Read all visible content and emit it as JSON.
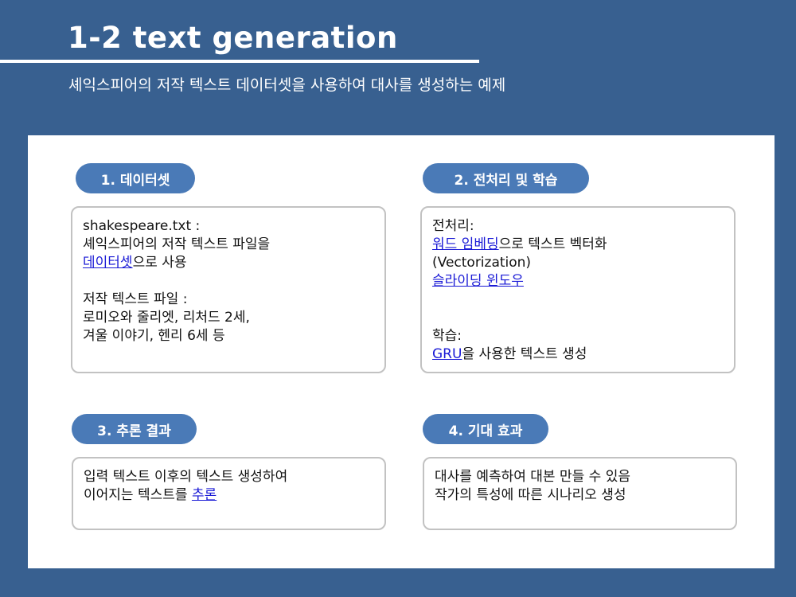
{
  "slide": {
    "title": "1-2 text generation",
    "subtitle": "셰익스피어의 저작 텍스트 데이터셋을 사용하여 대사를 생성하는 예제"
  },
  "sections": [
    {
      "heading": "1. 데이터셋",
      "lines": [
        {
          "text": "shakespeare.txt :"
        },
        {
          "text": "셰익스피어의 저작 텍스트 파일을"
        },
        {
          "link": "데이터셋",
          "rest": "으로 사용"
        },
        {
          "text": "저작 텍스트 파일 :"
        },
        {
          "text": "로미오와 줄리엣, 리처드 2세,"
        },
        {
          "text": "겨울 이야기, 헨리 6세 등"
        }
      ]
    },
    {
      "heading": "2. 전처리 및 학습",
      "lines": [
        {
          "text": "전처리:"
        },
        {
          "link": "워드 임베딩",
          "rest": "으로 텍스트 벡터화"
        },
        {
          "text": "(Vectorization)"
        },
        {
          "link": "슬라이딩 윈도우"
        },
        {
          "text": "학습:"
        },
        {
          "link": "GRU",
          "rest": "을 사용한 텍스트 생성"
        }
      ]
    },
    {
      "heading": "3. 추론 결과",
      "lines": [
        {
          "text": "입력 텍스트 이후의 텍스트 생성하여"
        },
        {
          "prefix": "이어지는 텍스트를 ",
          "link": "추론"
        }
      ]
    },
    {
      "heading": "4. 기대 효과",
      "lines": [
        {
          "text": "대사를 예측하여 대본 만들 수 있음"
        },
        {
          "text": "작가의 특성에 따른 시나리오 생성"
        }
      ]
    }
  ],
  "colors": {
    "background": "#386090",
    "pill": "#4a7ab7",
    "link": "#1a1ad6",
    "border": "#c2c2c2"
  }
}
